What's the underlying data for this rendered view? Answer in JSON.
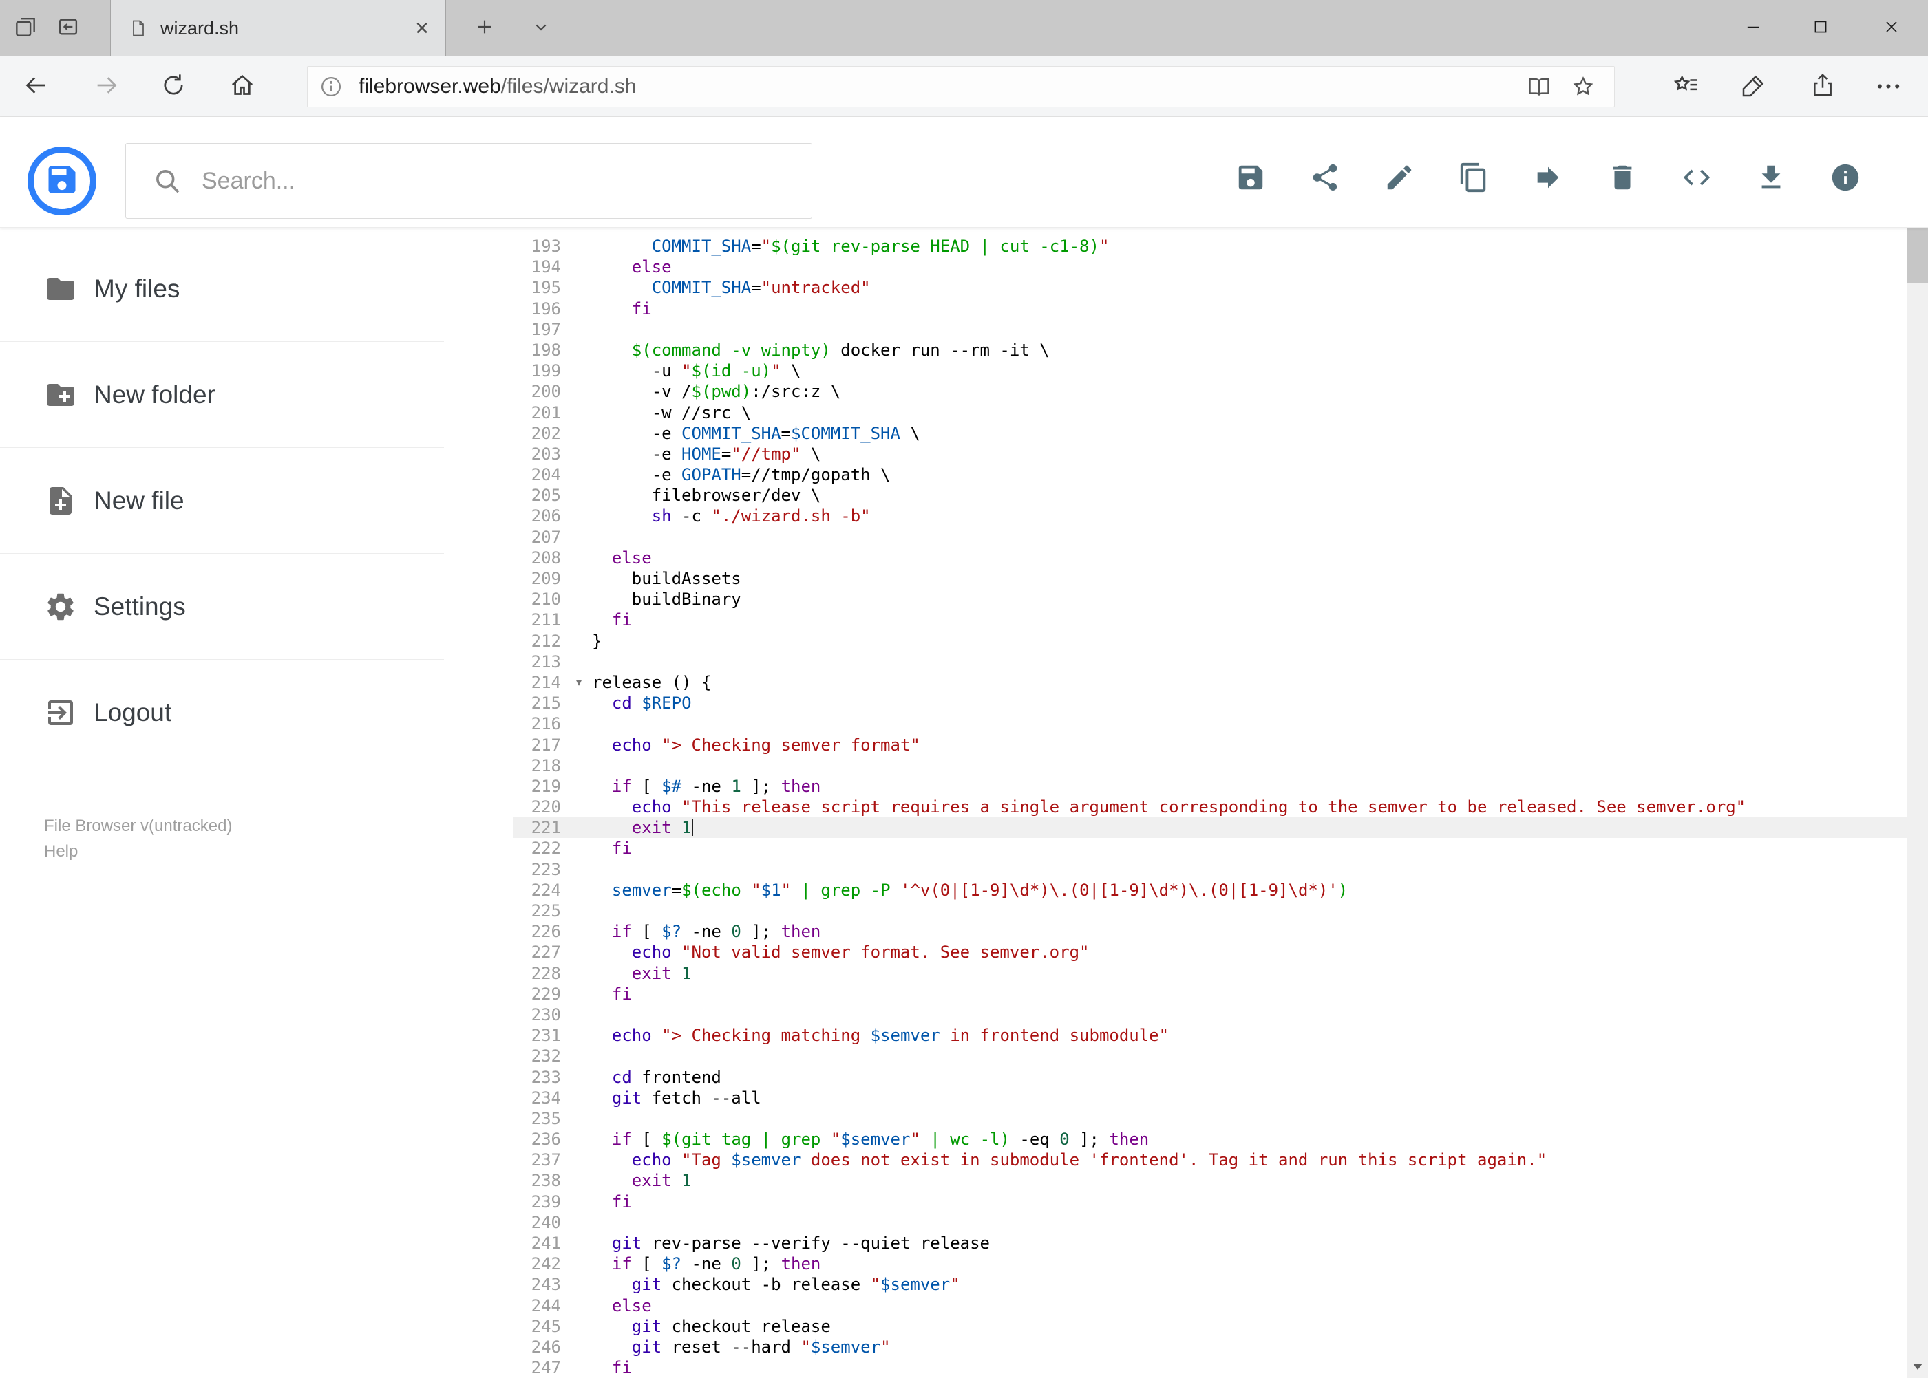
{
  "browser": {
    "tab_title": "wizard.sh",
    "url_domain": "filebrowser.web",
    "url_path": "/files/wizard.sh",
    "glyphs": {
      "close_tab": "×",
      "ellipsis": "•••"
    },
    "window_controls": [
      "minimize",
      "maximize",
      "close"
    ],
    "nav_icons": [
      "back",
      "forward",
      "refresh",
      "home",
      "page-info",
      "reading-view",
      "favorite-star",
      "favorites-hub",
      "ink-notes",
      "share",
      "more-ellipsis"
    ],
    "tabstrip_icons": [
      "tabs-set-aside",
      "set-tabs-aside",
      "new-tab",
      "tab-preview-chevron"
    ]
  },
  "app": {
    "logo_icon": "file-browser-floppy-logo",
    "search": {
      "placeholder": "Search..."
    },
    "toolbar_icons": [
      "save",
      "share",
      "rename",
      "copy",
      "move",
      "delete",
      "switch-view-code",
      "download",
      "info"
    ]
  },
  "sidebar": {
    "items": [
      {
        "label": "My files",
        "icon": "folder-icon"
      },
      {
        "label": "New folder",
        "icon": "new-folder-icon"
      },
      {
        "label": "New file",
        "icon": "new-file-icon"
      },
      {
        "label": "Settings",
        "icon": "gear-icon"
      },
      {
        "label": "Logout",
        "icon": "logout-icon"
      }
    ],
    "footer": {
      "version": "File Browser v(untracked)",
      "help": "Help"
    }
  },
  "editor": {
    "language": "shell",
    "first_line": 193,
    "active_line": 221,
    "fold_line": 214,
    "fold_marker": "▾",
    "lines": [
      "      COMMIT_SHA=\"$(git rev-parse HEAD | cut -c1-8)\"",
      "    else",
      "      COMMIT_SHA=\"untracked\"",
      "    fi",
      "",
      "    $(command -v winpty) docker run --rm -it \\",
      "      -u \"$(id -u)\" \\",
      "      -v /$(pwd):/src:z \\",
      "      -w //src \\",
      "      -e COMMIT_SHA=$COMMIT_SHA \\",
      "      -e HOME=\"//tmp\" \\",
      "      -e GOPATH=//tmp/gopath \\",
      "      filebrowser/dev \\",
      "      sh -c \"./wizard.sh -b\"",
      "",
      "  else",
      "    buildAssets",
      "    buildBinary",
      "  fi",
      "}",
      "",
      "release () {",
      "  cd $REPO",
      "",
      "  echo \"> Checking semver format\"",
      "",
      "  if [ $# -ne 1 ]; then",
      "    echo \"This release script requires a single argument corresponding to the semver to be released. See semver.org\"",
      "    exit 1",
      "  fi",
      "",
      "  semver=$(echo \"$1\" | grep -P '^v(0|[1-9]\\d*)\\.(0|[1-9]\\d*)\\.(0|[1-9]\\d*)')",
      "",
      "  if [ $? -ne 0 ]; then",
      "    echo \"Not valid semver format. See semver.org\"",
      "    exit 1",
      "  fi",
      "",
      "  echo \"> Checking matching $semver in frontend submodule\"",
      "",
      "  cd frontend",
      "  git fetch --all",
      "",
      "  if [ $(git tag | grep \"$semver\" | wc -l) -eq 0 ]; then",
      "    echo \"Tag $semver does not exist in submodule 'frontend'. Tag it and run this script again.\"",
      "    exit 1",
      "  fi",
      "",
      "  git rev-parse --verify --quiet release",
      "  if [ $? -ne 0 ]; then",
      "    git checkout -b release \"$semver\"",
      "  else",
      "    git checkout release",
      "    git reset --hard \"$semver\"",
      "  fi"
    ]
  },
  "colors": {
    "accent_blue": "#2d7ff9",
    "toolbar_icon": "#546e7a",
    "tabstrip_bg": "#c9c9c9",
    "navbar_bg": "#f4f5f6",
    "syntax": {
      "keyword": "#770088",
      "string": "#aa1111",
      "subshell": "#009900",
      "builtin": "#3300aa",
      "number": "#116644",
      "variable": "#0055aa",
      "line_number": "#9e9e9e",
      "active_line_bg": "#f0f0f0"
    }
  }
}
